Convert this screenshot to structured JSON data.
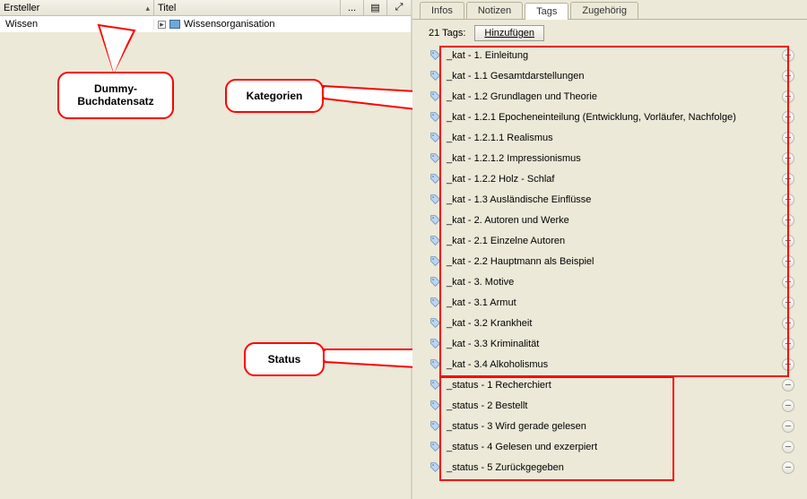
{
  "left": {
    "columns": {
      "ersteller": "Ersteller",
      "titel": "Titel",
      "dots": "...",
      "paper": "▤"
    },
    "row": {
      "ersteller": "Wissen",
      "titel": "Wissensorganisation",
      "toggle": "▸"
    }
  },
  "callouts": {
    "dummy_l1": "Dummy-",
    "dummy_l2": "Buchdatensatz",
    "kategorien": "Kategorien",
    "status": "Status"
  },
  "right": {
    "tabs": [
      "Infos",
      "Notizen",
      "Tags",
      "Zugehörig"
    ],
    "active_tab_index": 2,
    "tag_count_label": "21 Tags:",
    "add_button": "Hinzufügen",
    "tags": [
      "_kat - 1. Einleitung",
      "_kat - 1.1 Gesamtdarstellungen",
      "_kat - 1.2 Grundlagen und Theorie",
      "_kat - 1.2.1 Epocheneinteilung (Entwicklung, Vorläufer, Nachfolge)",
      "_kat - 1.2.1.1 Realismus",
      "_kat - 1.2.1.2 Impressionismus",
      "_kat - 1.2.2 Holz - Schlaf",
      "_kat - 1.3 Ausländische Einflüsse",
      "_kat - 2. Autoren und Werke",
      "_kat - 2.1 Einzelne Autoren",
      "_kat - 2.2 Hauptmann als Beispiel",
      "_kat - 3. Motive",
      "_kat - 3.1 Armut",
      "_kat - 3.2 Krankheit",
      "_kat - 3.3 Kriminalität",
      "_kat - 3.4 Alkoholismus",
      "_status - 1 Recherchiert",
      "_status - 2 Bestellt",
      "_status - 3 Wird gerade gelesen",
      "_status - 4 Gelesen und exzerpiert",
      "_status - 5 Zurückgegeben"
    ]
  }
}
